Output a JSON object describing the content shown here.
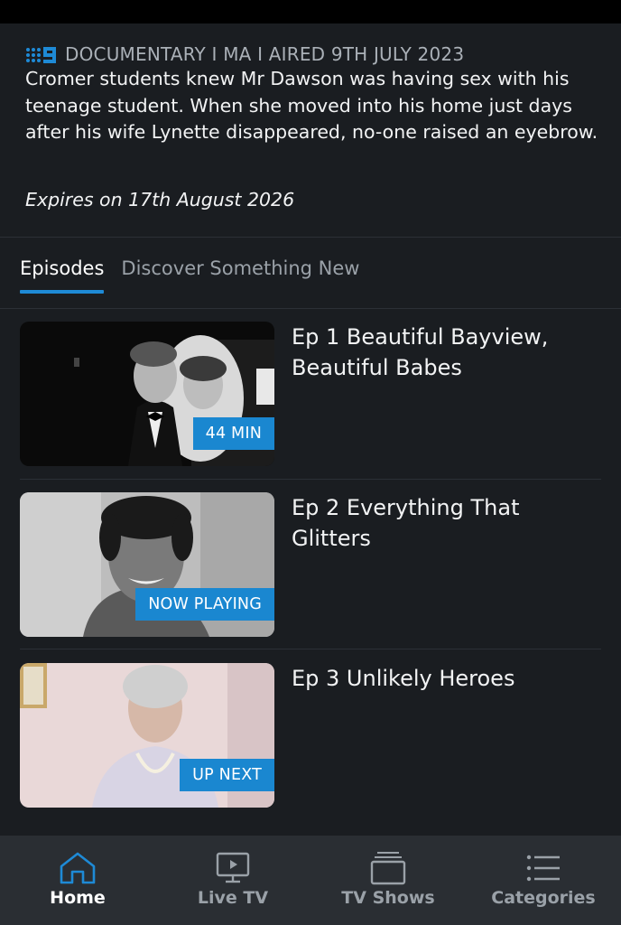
{
  "show": {
    "meta": "DOCUMENTARY I MA I AIRED 9TH JULY 2023",
    "description": "Cromer students knew Mr Dawson was having sex with his teenage student. When she moved into his home just days after his wife Lynette disappeared, no-one raised an eyebrow.",
    "expires": "Expires on 17th August 2026"
  },
  "tabs": [
    {
      "label": "Episodes",
      "active": true
    },
    {
      "label": "Discover Something New",
      "active": false
    }
  ],
  "episodes": [
    {
      "title": "Ep 1 Beautiful Bayview, Beautiful Babes",
      "badge": "44 MIN"
    },
    {
      "title": "Ep 2 Everything That Glitters",
      "badge": "NOW PLAYING"
    },
    {
      "title": "Ep 3 Unlikely Heroes",
      "badge": "UP NEXT"
    }
  ],
  "nav": [
    {
      "label": "Home",
      "icon": "home-icon",
      "active": true
    },
    {
      "label": "Live TV",
      "icon": "live-tv-icon",
      "active": false
    },
    {
      "label": "TV Shows",
      "icon": "tv-shows-icon",
      "active": false
    },
    {
      "label": "Categories",
      "icon": "categories-icon",
      "active": false
    }
  ],
  "colors": {
    "accent": "#1a87d0",
    "background": "#1a1d21",
    "nav_background": "#2a2e33"
  }
}
